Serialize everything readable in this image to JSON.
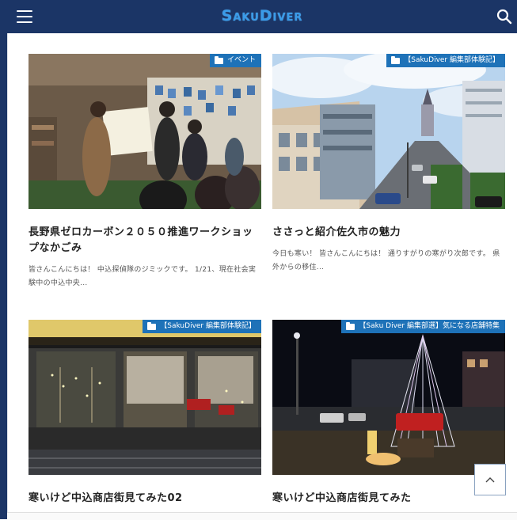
{
  "header": {
    "logo": "SakuDiver",
    "menu_icon": "hamburger-menu-icon",
    "search_icon": "search-icon",
    "background": "#1b3566",
    "logo_color": "#3a9be8"
  },
  "articles": [
    {
      "category": "イベント",
      "title": "長野県ゼロカーボン２０５０推進ワークショップなかごみ",
      "excerpt": "皆さんこんにちは！ 中込探偵隊のジミックです。 1/21、現在社会実験中の中込中央..."
    },
    {
      "category": "【SakuDiver 編集部体験記】",
      "title": "ささっと紹介佐久市の魅力",
      "excerpt": "今日も寒い！ 皆さんこんにちは！ 通りすがりの寒がり次郎です。 県外からの移住..."
    },
    {
      "category": "【SakuDiver 編集部体験記】",
      "title": "寒いけど中込商店街見てみた02",
      "excerpt": ""
    },
    {
      "category": "【Saku Diver 編集部選】気になる店舗特集",
      "title": "寒いけど中込商店街見てみた",
      "excerpt": ""
    }
  ],
  "colors": {
    "category_bg": "#1e72b8"
  },
  "back_to_top_icon": "chevron-up-icon"
}
